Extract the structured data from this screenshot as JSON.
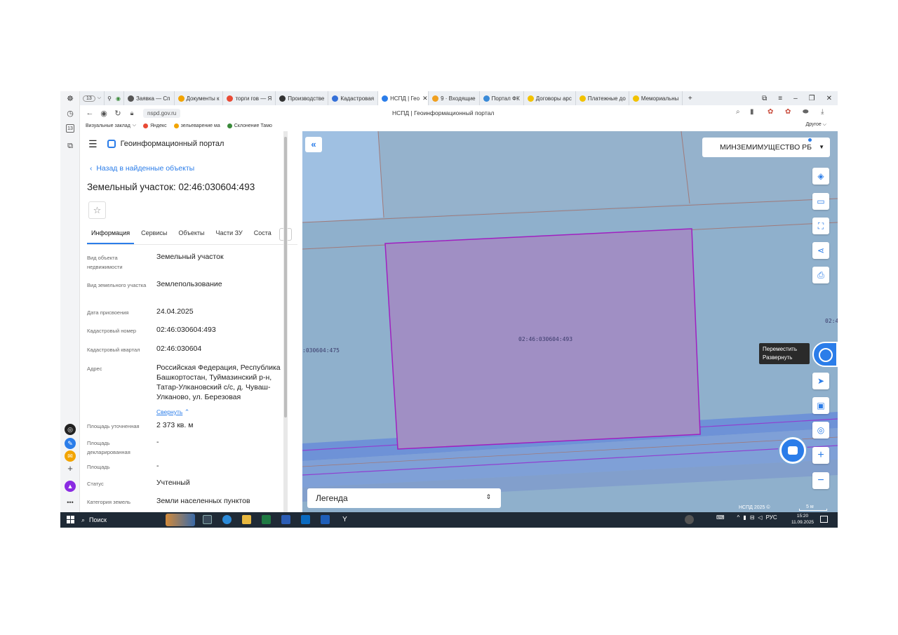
{
  "colors": {
    "accent": "#2b7de9",
    "map_base": "#8fb0cc",
    "parcel_fill": "#a08fc4",
    "parcel_stroke": "#a020c0",
    "road_band": "#5b85d6",
    "taskbar": "#1f2a36"
  },
  "browser": {
    "tabs": [
      {
        "label": "Заявка — Сп",
        "fav_color": "#555555"
      },
      {
        "label": "Документы к",
        "fav_color": "#f2a400"
      },
      {
        "label": "торги гов — Я",
        "fav_color": "#e94a35"
      },
      {
        "label": "Производстве",
        "fav_color": "#333333"
      },
      {
        "label": "Кадастровая",
        "fav_color": "#3570d8"
      },
      {
        "label": "НСПД | Гео",
        "fav_color": "#2b7de9",
        "active": true
      },
      {
        "label": "9 · Входящие",
        "fav_color": "#f0a020"
      },
      {
        "label": "Портал ФК",
        "fav_color": "#3a8ad8"
      },
      {
        "label": "Договоры арс",
        "fav_color": "#f2c200"
      },
      {
        "label": "Платежные до",
        "fav_color": "#f2c200"
      },
      {
        "label": "Мемориальны",
        "fav_color": "#f2c200"
      }
    ],
    "tab_count_badge": "13",
    "url": "nspd.gov.ru",
    "page_title": "НСПД | Геоинформационный портал",
    "bookmarks": [
      {
        "label": "Визуальные заклад",
        "color": "#ffffff"
      },
      {
        "label": "Яндекс",
        "color": "#e94a35"
      },
      {
        "label": "зельеварение ма",
        "color": "#f2a400"
      },
      {
        "label": "Склонение Тамо",
        "color": "#3a8a3a"
      }
    ],
    "bookmarks_other": "Другое"
  },
  "panel": {
    "portal_name": "Геоинформационный портал",
    "back_link": "Назад в найденные объекты",
    "object_title": "Земельный участок: 02:46:030604:493",
    "tabs": [
      "Информация",
      "Сервисы",
      "Объекты",
      "Части ЗУ",
      "Соста"
    ],
    "active_tab": "Информация",
    "properties": [
      {
        "label": "Вид объекта недвижимости",
        "value": "Земельный участок"
      },
      {
        "label": "Вид земельного участка",
        "value": "Землепользование"
      },
      {
        "label": "Дата присвоения",
        "value": "24.04.2025"
      },
      {
        "label": "Кадастровый номер",
        "value": "02:46:030604:493"
      },
      {
        "label": "Кадастровый квартал",
        "value": "02:46:030604"
      },
      {
        "label": "Адрес",
        "value": "Российская Федерация, Республика Башкортостан, Туймазинский р-н, Татар-Улкановский с/с, д. Чуваш-Улканово, ул. Березовая"
      },
      {
        "label": "Площадь уточненная",
        "value": "2 373 кв. м"
      },
      {
        "label": "Площадь декларированная",
        "value": "-"
      },
      {
        "label": "Площадь",
        "value": "-"
      },
      {
        "label": "Статус",
        "value": "Учтенный"
      },
      {
        "label": "Категория земель",
        "value": "Земли населенных пунктов"
      }
    ],
    "collapse_link": "Свернуть"
  },
  "map": {
    "ministry_select": "МИНЗЕМИМУЩЕСТВО РБ",
    "parcel_label": "02:46:030604:493",
    "neighbor_label": ":030604:475",
    "edge_label": "02:4",
    "tooltip_line1": "Переместить",
    "tooltip_line2": "Развернуть",
    "legend_label": "Легенда",
    "copyright": "НСПД 2025 ©",
    "scale": "5 м"
  },
  "taskbar": {
    "search_label": "Поиск",
    "lang": "РУС",
    "time": "15:20",
    "date": "11.09.2025"
  }
}
